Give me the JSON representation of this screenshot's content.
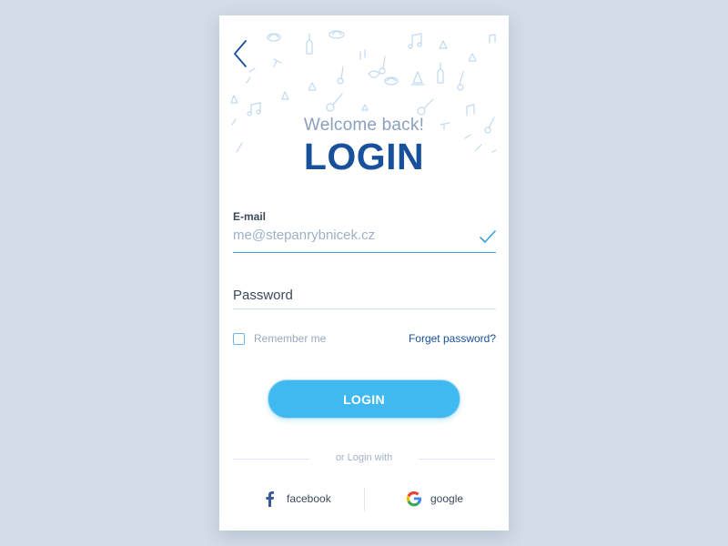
{
  "header": {
    "back_icon": "chevron-left-icon",
    "welcome_text": "Welcome back!",
    "title": "LOGIN"
  },
  "form": {
    "email_label": "E-mail",
    "email_value": "me@stepanrybnicek.cz",
    "email_valid_icon": "check-icon",
    "password_placeholder": "Password",
    "remember_label": "Remember me",
    "remember_checked": false,
    "forgot_label": "Forget password?",
    "login_button": "LOGIN"
  },
  "social": {
    "divider_text": "or Login with",
    "facebook_label": "facebook",
    "google_label": "google"
  },
  "colors": {
    "background": "#d3dce8",
    "brand_dark_blue": "#17509b",
    "accent_blue": "#3fb9ef",
    "muted_text": "#98a8bd"
  }
}
